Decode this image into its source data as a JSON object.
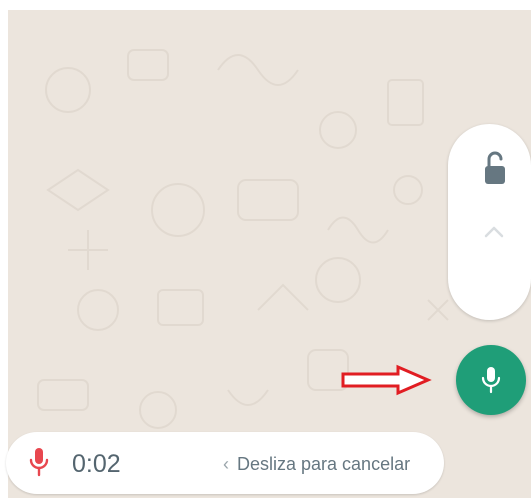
{
  "recording": {
    "timer": "0:02",
    "cancel_hint": "Desliza para cancelar",
    "cancel_chevron": "‹"
  },
  "icons": {
    "lock": "unlock-icon",
    "lock_chevron": "chevron-up-icon",
    "mic_fab": "mic-icon",
    "rec_mic": "mic-icon",
    "arrow": "right-arrow-icon"
  },
  "colors": {
    "chat_background": "#ece5dd",
    "mic_fab": "#1f9e78",
    "recording_mic": "#e8474f",
    "annotation_arrow": "#e11d22"
  }
}
